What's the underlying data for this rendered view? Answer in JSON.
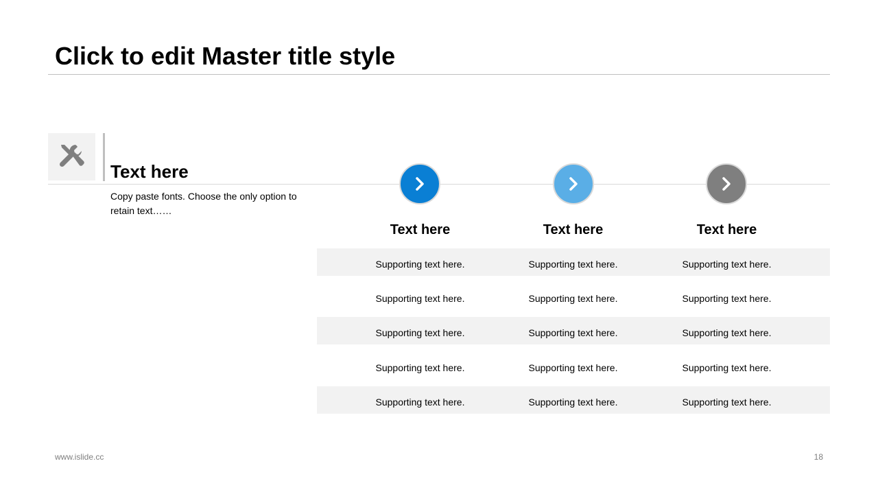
{
  "slide": {
    "title": "Click to edit Master title style",
    "side": {
      "icon": "tools-icon",
      "heading": "Text here",
      "body": "Copy paste fonts. Choose the only option to retain text……"
    },
    "steps": [
      {
        "heading": "Text here",
        "color": "#0a7fd4",
        "icon": "chevron-right-icon"
      },
      {
        "heading": "Text here",
        "color": "#5aaee6",
        "icon": "chevron-right-icon"
      },
      {
        "heading": "Text here",
        "color": "#7f7f7f",
        "icon": "chevron-right-icon"
      }
    ],
    "table": {
      "rows": [
        [
          "Supporting text here.",
          "Supporting text here.",
          "Supporting text here."
        ],
        [
          "Supporting text here.",
          "Supporting text here.",
          "Supporting text here."
        ],
        [
          "Supporting text here.",
          "Supporting text here.",
          "Supporting text here."
        ],
        [
          "Supporting text here.",
          "Supporting text here.",
          "Supporting text here."
        ],
        [
          "Supporting text here.",
          "Supporting text here.",
          "Supporting text here."
        ]
      ]
    }
  },
  "footer": {
    "url": "www.islide.cc",
    "page_number": "18"
  }
}
